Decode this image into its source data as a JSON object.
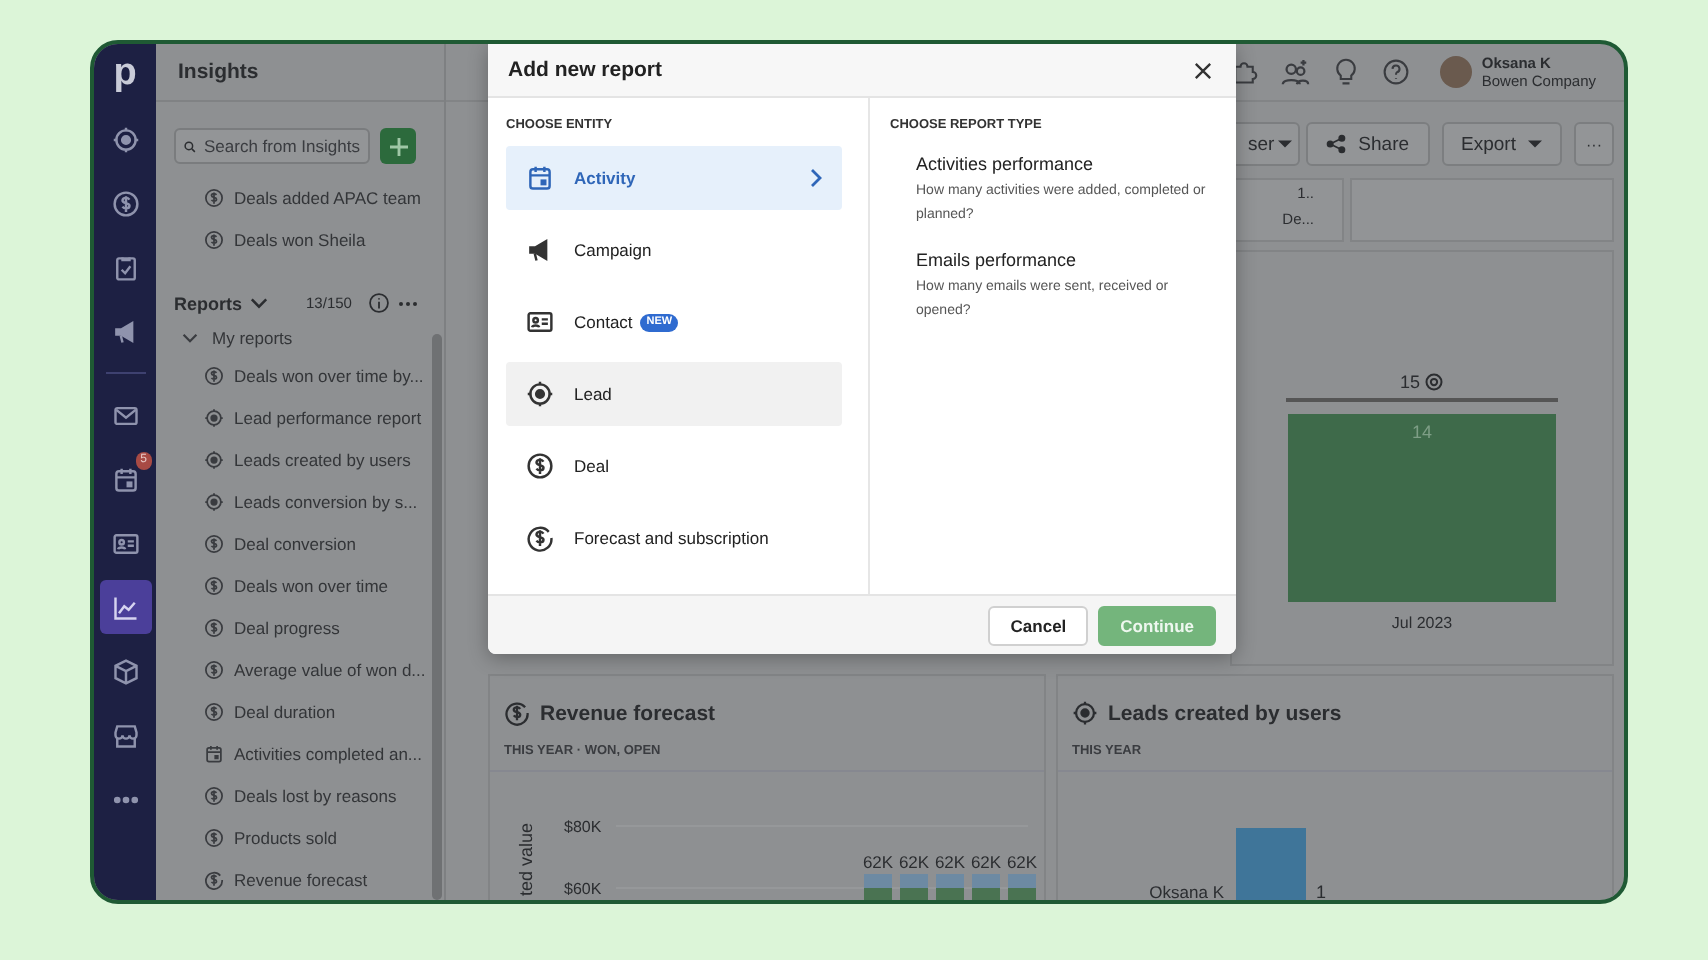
{
  "nav": {
    "logo": "p",
    "top_items": [
      {
        "kind": "target",
        "selected": false
      },
      {
        "kind": "dollar",
        "selected": false
      },
      {
        "kind": "checklist",
        "selected": false
      },
      {
        "kind": "megaphone",
        "selected": false
      }
    ],
    "items": [
      {
        "kind": "mail",
        "selected": false
      },
      {
        "kind": "calendar",
        "selected": false,
        "badge": "5"
      },
      {
        "kind": "card",
        "selected": false
      },
      {
        "kind": "chart",
        "selected": true
      },
      {
        "kind": "box",
        "selected": false
      },
      {
        "kind": "store",
        "selected": false
      },
      {
        "kind": "more",
        "selected": false
      }
    ]
  },
  "sidebar": {
    "title": "Insights",
    "search": {
      "placeholder": "Search from Insights"
    },
    "pinned": [
      {
        "kind": "dollar",
        "label": "Deals added APAC team"
      },
      {
        "kind": "dollar",
        "label": "Deals won Sheila"
      }
    ],
    "reports": {
      "title": "Reports",
      "count": "13/150",
      "expanded": true,
      "children": [
        {
          "label": "My reports",
          "expanded": true,
          "children": [
            {
              "kind": "dollar",
              "label": "Deals won over time by..."
            },
            {
              "kind": "target",
              "label": "Lead performance report"
            },
            {
              "kind": "target",
              "label": "Leads created by users"
            },
            {
              "kind": "target",
              "label": "Leads conversion by s..."
            },
            {
              "kind": "dollar",
              "label": "Deal conversion"
            },
            {
              "kind": "dollar",
              "label": "Deals won over time"
            },
            {
              "kind": "dollar",
              "label": "Deal progress"
            },
            {
              "kind": "dollar",
              "label": "Average value of won d..."
            },
            {
              "kind": "dollar",
              "label": "Deal duration"
            },
            {
              "kind": "calendar",
              "label": "Activities completed an..."
            },
            {
              "kind": "dollar",
              "label": "Deals lost by reasons"
            },
            {
              "kind": "dollar",
              "label": "Products sold"
            },
            {
              "kind": "forecast",
              "label": "Revenue forecast"
            }
          ]
        }
      ]
    }
  },
  "topbar": {
    "user": {
      "name": "Oksana K",
      "company": "Bowen Company"
    }
  },
  "toolbar": [
    {
      "kind": "dropdown",
      "label": "ser"
    },
    {
      "kind": "share",
      "label": "Share"
    },
    {
      "kind": "dropdown",
      "label": "Export"
    },
    {
      "kind": "plain",
      "label": "···"
    }
  ],
  "goal_card": {
    "value": "1..",
    "caption": "De..."
  },
  "goal_chart": {
    "goal": "15",
    "bar_value": "14",
    "category": "Jul 2023"
  },
  "revenue_card": {
    "title": "Revenue forecast",
    "filters": [
      "THIS YEAR · WON, OPEN"
    ],
    "y_axis_label": "ted value",
    "y_ticks": [
      "$80K",
      "$60K"
    ],
    "bar_labels": [
      "62K",
      "62K",
      "62K",
      "62K",
      "62K"
    ]
  },
  "leads_card": {
    "title": "Leads created by users",
    "filter": "THIS YEAR",
    "row_label": "Oksana K",
    "bar_label": "1"
  },
  "modal": {
    "title": "Add new report",
    "entity_heading": "CHOOSE ENTITY",
    "entities": [
      {
        "kind": "calendar",
        "label": "Activity",
        "selected": true,
        "hovered": false
      },
      {
        "kind": "megaphone",
        "label": "Campaign",
        "selected": false,
        "hovered": false
      },
      {
        "kind": "card",
        "label": "Contact",
        "selected": false,
        "hovered": false,
        "badge": "NEW"
      },
      {
        "kind": "target",
        "label": "Lead",
        "selected": false,
        "hovered": true
      },
      {
        "kind": "dollar",
        "label": "Deal",
        "selected": false,
        "hovered": false
      },
      {
        "kind": "forecast",
        "label": "Forecast and subscription",
        "selected": false,
        "hovered": false
      }
    ],
    "type_heading": "CHOOSE REPORT TYPE",
    "report_types": [
      {
        "title": "Activities performance",
        "description": "How many activities were added, completed or planned?"
      },
      {
        "title": "Emails performance",
        "description": "How many emails were sent, received or opened?"
      }
    ],
    "buttons": [
      {
        "kind": "secondary",
        "label": "Cancel"
      },
      {
        "kind": "primary",
        "label": "Continue"
      }
    ]
  }
}
